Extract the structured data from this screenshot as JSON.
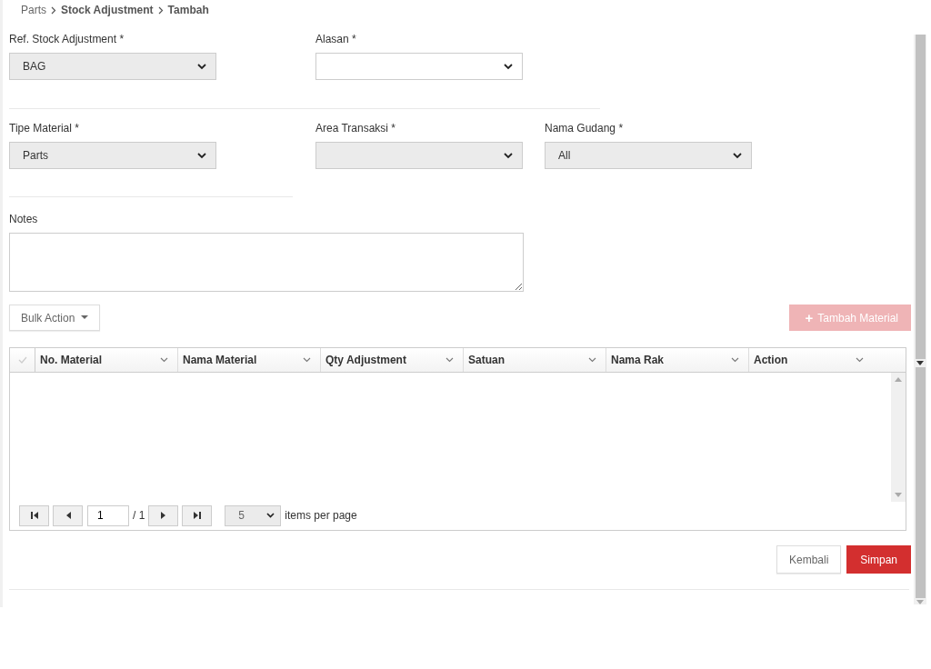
{
  "breadcrumb": [
    {
      "label": "Parts",
      "current": false
    },
    {
      "label": "Stock Adjustment",
      "current": true
    },
    {
      "label": "Tambah",
      "current": true
    }
  ],
  "field_rows": [
    [
      {
        "label": "Ref. Stock Adjustment *",
        "value": "BAG",
        "disabled": true
      },
      {
        "label": "Alasan *",
        "disabled": false
      }
    ],
    [
      {
        "label": "Tipe Material *",
        "value": "Parts",
        "disabled": true
      },
      {
        "label": "Area Transaksi *",
        "disabled": true
      },
      {
        "label": "Nama Gudang *",
        "value": "All",
        "disabled": true
      }
    ]
  ],
  "notes": {
    "label": "Notes"
  },
  "bulk_action": {
    "label": "Bulk Action"
  },
  "add_button": {
    "icon": "+",
    "label": "Tambah Material",
    "disabled": true
  },
  "table": {
    "select_all": {
      "checked": false
    },
    "columns": [
      "No. Material",
      "Nama Material",
      "Qty Adjustment",
      "Satuan",
      "Nama Rak",
      "Action"
    ]
  },
  "pager": {
    "page": "1",
    "of": "/ 1",
    "page_size": "5",
    "page_size_label": "items per page"
  },
  "buttons": [
    {
      "label": "Kembali",
      "kind": "secondary"
    },
    {
      "label": "Simpan",
      "kind": "primary"
    }
  ]
}
